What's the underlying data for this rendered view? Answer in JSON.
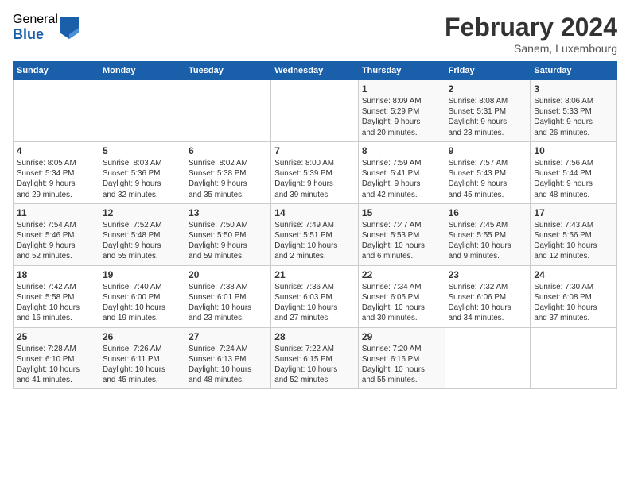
{
  "header": {
    "logo_general": "General",
    "logo_blue": "Blue",
    "month_title": "February 2024",
    "location": "Sanem, Luxembourg"
  },
  "days_of_week": [
    "Sunday",
    "Monday",
    "Tuesday",
    "Wednesday",
    "Thursday",
    "Friday",
    "Saturday"
  ],
  "weeks": [
    [
      {
        "day": "",
        "info": ""
      },
      {
        "day": "",
        "info": ""
      },
      {
        "day": "",
        "info": ""
      },
      {
        "day": "",
        "info": ""
      },
      {
        "day": "1",
        "info": "Sunrise: 8:09 AM\nSunset: 5:29 PM\nDaylight: 9 hours\nand 20 minutes."
      },
      {
        "day": "2",
        "info": "Sunrise: 8:08 AM\nSunset: 5:31 PM\nDaylight: 9 hours\nand 23 minutes."
      },
      {
        "day": "3",
        "info": "Sunrise: 8:06 AM\nSunset: 5:33 PM\nDaylight: 9 hours\nand 26 minutes."
      }
    ],
    [
      {
        "day": "4",
        "info": "Sunrise: 8:05 AM\nSunset: 5:34 PM\nDaylight: 9 hours\nand 29 minutes."
      },
      {
        "day": "5",
        "info": "Sunrise: 8:03 AM\nSunset: 5:36 PM\nDaylight: 9 hours\nand 32 minutes."
      },
      {
        "day": "6",
        "info": "Sunrise: 8:02 AM\nSunset: 5:38 PM\nDaylight: 9 hours\nand 35 minutes."
      },
      {
        "day": "7",
        "info": "Sunrise: 8:00 AM\nSunset: 5:39 PM\nDaylight: 9 hours\nand 39 minutes."
      },
      {
        "day": "8",
        "info": "Sunrise: 7:59 AM\nSunset: 5:41 PM\nDaylight: 9 hours\nand 42 minutes."
      },
      {
        "day": "9",
        "info": "Sunrise: 7:57 AM\nSunset: 5:43 PM\nDaylight: 9 hours\nand 45 minutes."
      },
      {
        "day": "10",
        "info": "Sunrise: 7:56 AM\nSunset: 5:44 PM\nDaylight: 9 hours\nand 48 minutes."
      }
    ],
    [
      {
        "day": "11",
        "info": "Sunrise: 7:54 AM\nSunset: 5:46 PM\nDaylight: 9 hours\nand 52 minutes."
      },
      {
        "day": "12",
        "info": "Sunrise: 7:52 AM\nSunset: 5:48 PM\nDaylight: 9 hours\nand 55 minutes."
      },
      {
        "day": "13",
        "info": "Sunrise: 7:50 AM\nSunset: 5:50 PM\nDaylight: 9 hours\nand 59 minutes."
      },
      {
        "day": "14",
        "info": "Sunrise: 7:49 AM\nSunset: 5:51 PM\nDaylight: 10 hours\nand 2 minutes."
      },
      {
        "day": "15",
        "info": "Sunrise: 7:47 AM\nSunset: 5:53 PM\nDaylight: 10 hours\nand 6 minutes."
      },
      {
        "day": "16",
        "info": "Sunrise: 7:45 AM\nSunset: 5:55 PM\nDaylight: 10 hours\nand 9 minutes."
      },
      {
        "day": "17",
        "info": "Sunrise: 7:43 AM\nSunset: 5:56 PM\nDaylight: 10 hours\nand 12 minutes."
      }
    ],
    [
      {
        "day": "18",
        "info": "Sunrise: 7:42 AM\nSunset: 5:58 PM\nDaylight: 10 hours\nand 16 minutes."
      },
      {
        "day": "19",
        "info": "Sunrise: 7:40 AM\nSunset: 6:00 PM\nDaylight: 10 hours\nand 19 minutes."
      },
      {
        "day": "20",
        "info": "Sunrise: 7:38 AM\nSunset: 6:01 PM\nDaylight: 10 hours\nand 23 minutes."
      },
      {
        "day": "21",
        "info": "Sunrise: 7:36 AM\nSunset: 6:03 PM\nDaylight: 10 hours\nand 27 minutes."
      },
      {
        "day": "22",
        "info": "Sunrise: 7:34 AM\nSunset: 6:05 PM\nDaylight: 10 hours\nand 30 minutes."
      },
      {
        "day": "23",
        "info": "Sunrise: 7:32 AM\nSunset: 6:06 PM\nDaylight: 10 hours\nand 34 minutes."
      },
      {
        "day": "24",
        "info": "Sunrise: 7:30 AM\nSunset: 6:08 PM\nDaylight: 10 hours\nand 37 minutes."
      }
    ],
    [
      {
        "day": "25",
        "info": "Sunrise: 7:28 AM\nSunset: 6:10 PM\nDaylight: 10 hours\nand 41 minutes."
      },
      {
        "day": "26",
        "info": "Sunrise: 7:26 AM\nSunset: 6:11 PM\nDaylight: 10 hours\nand 45 minutes."
      },
      {
        "day": "27",
        "info": "Sunrise: 7:24 AM\nSunset: 6:13 PM\nDaylight: 10 hours\nand 48 minutes."
      },
      {
        "day": "28",
        "info": "Sunrise: 7:22 AM\nSunset: 6:15 PM\nDaylight: 10 hours\nand 52 minutes."
      },
      {
        "day": "29",
        "info": "Sunrise: 7:20 AM\nSunset: 6:16 PM\nDaylight: 10 hours\nand 55 minutes."
      },
      {
        "day": "",
        "info": ""
      },
      {
        "day": "",
        "info": ""
      }
    ]
  ]
}
